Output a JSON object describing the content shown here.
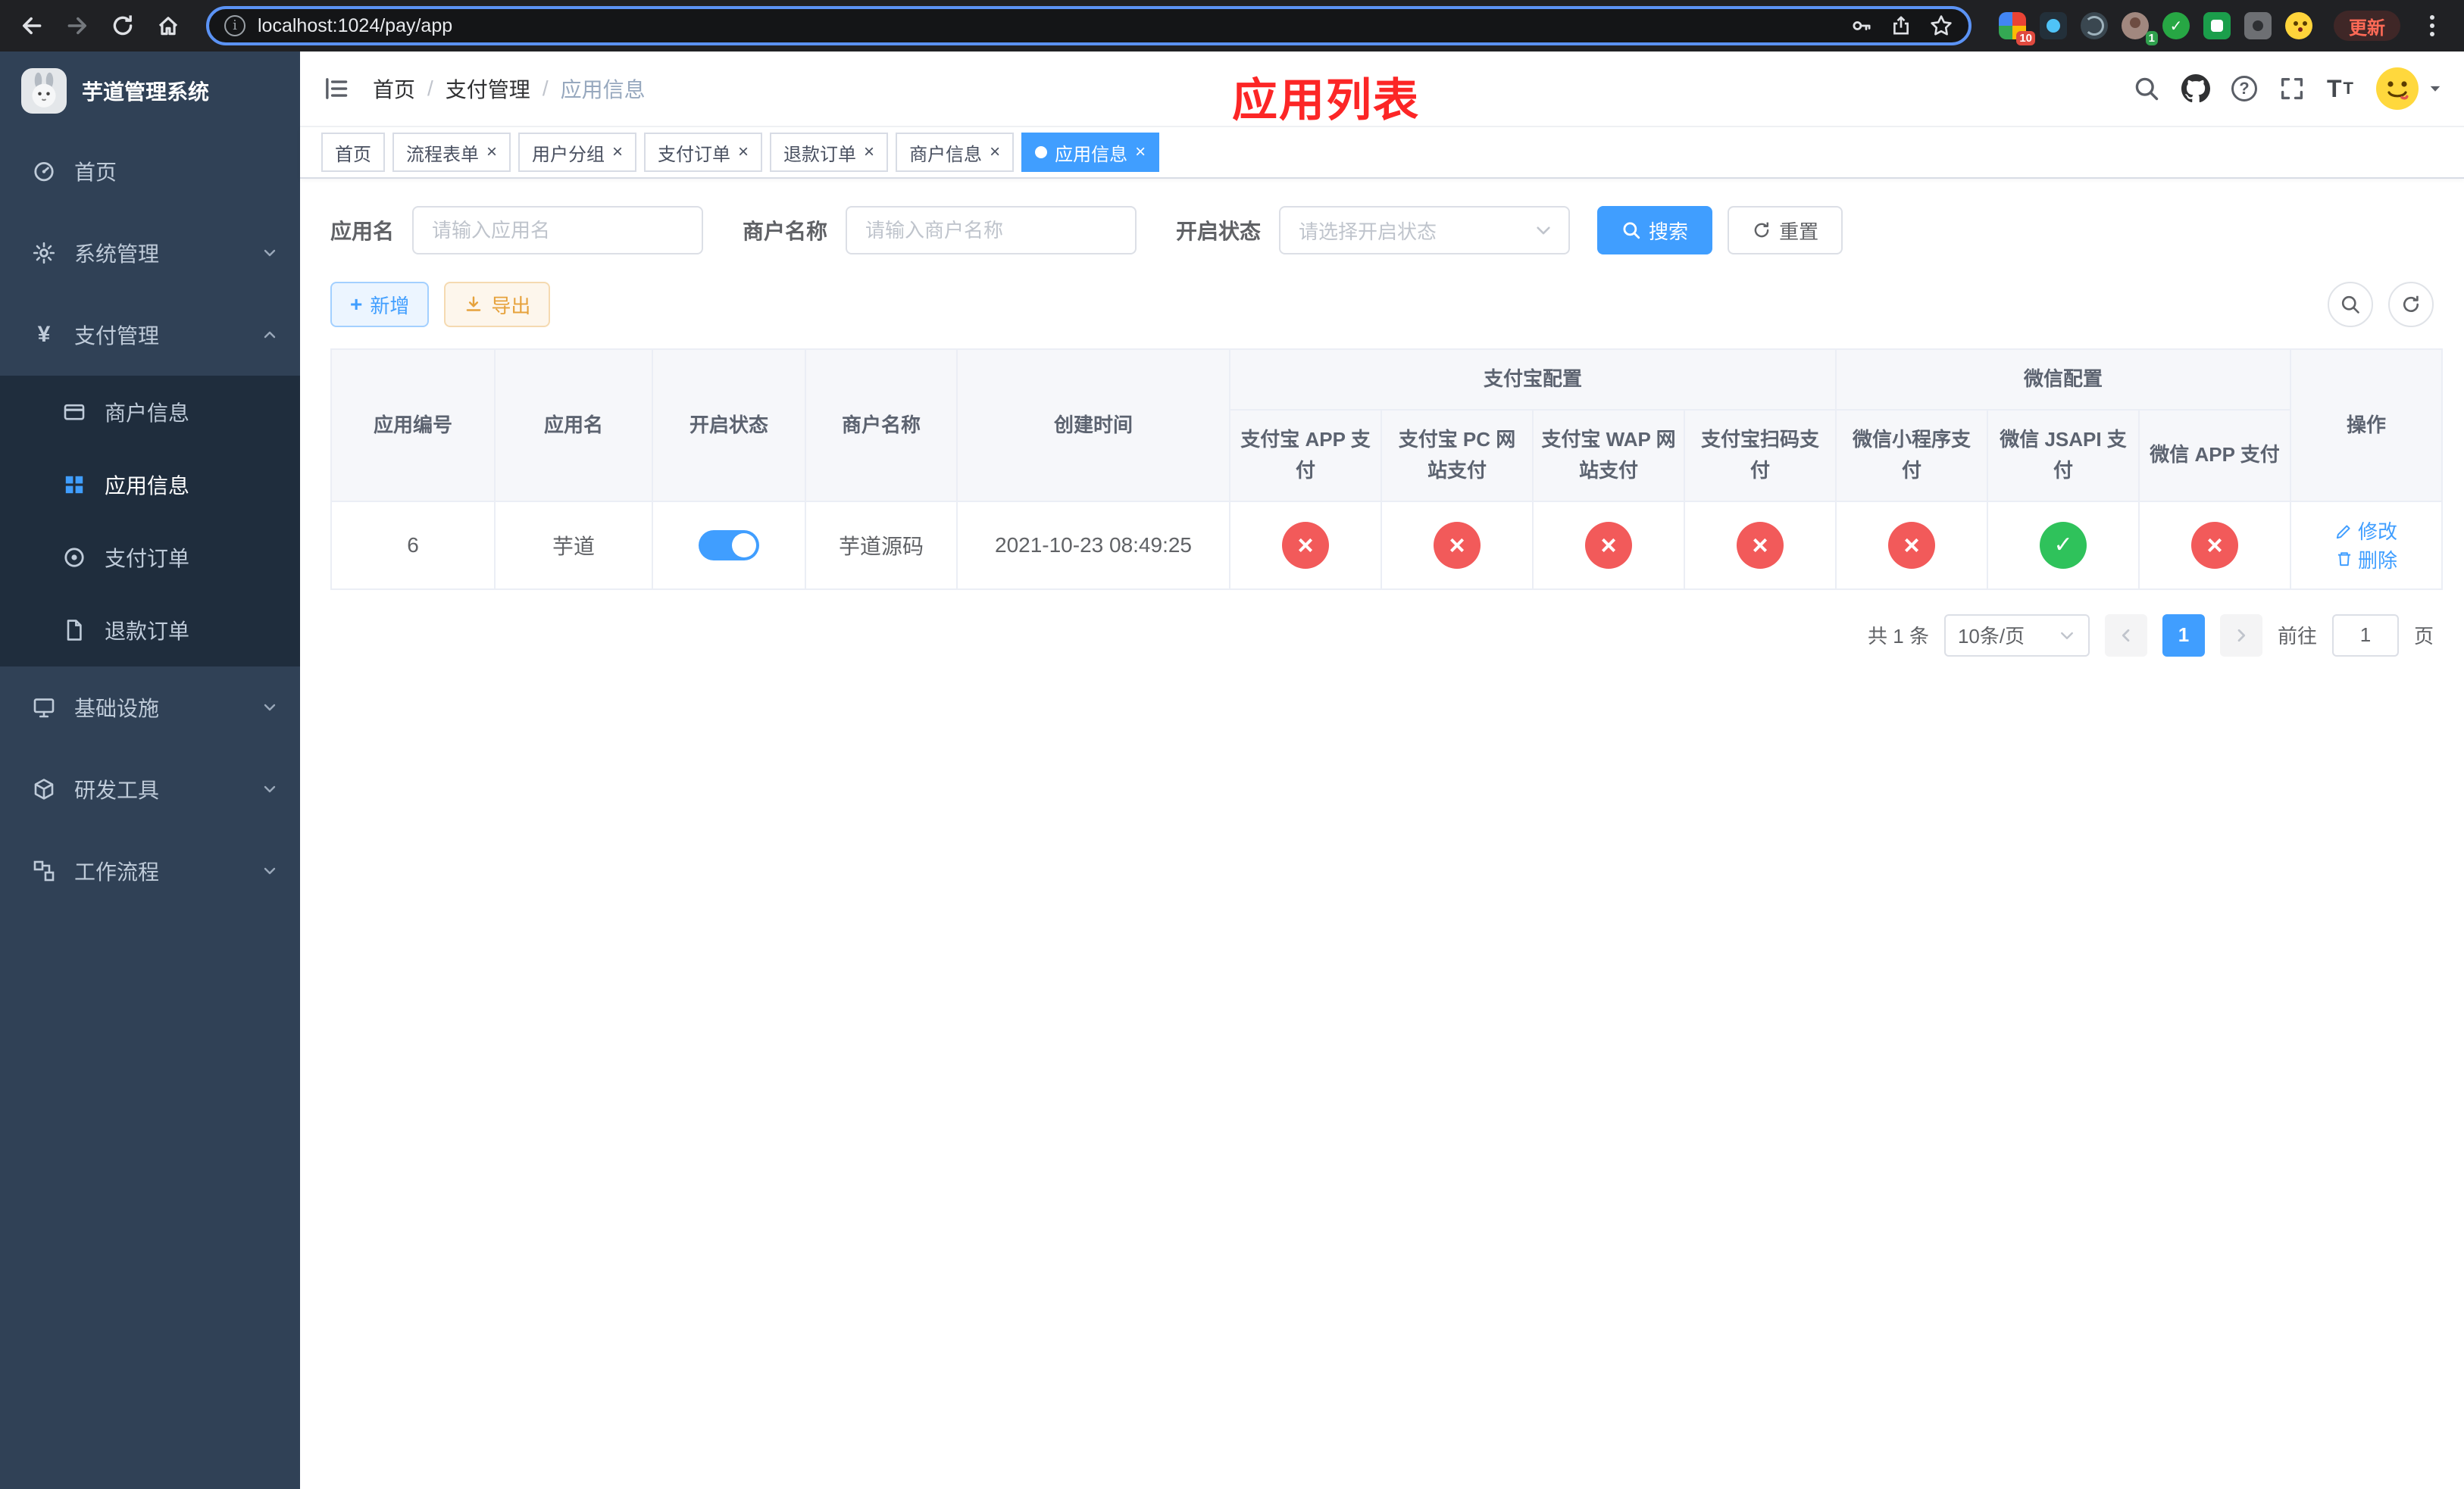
{
  "colors": {
    "accent": "#409eff",
    "success": "#2fc25b",
    "danger": "#f25a5a",
    "sidebar_bg": "#304156",
    "submenu_bg": "#1f2d3d",
    "annotation_red": "#fc2626"
  },
  "browser": {
    "url": "localhost:1024/pay/app",
    "update_label": "更新",
    "extension_badge_count": "10",
    "profile_badge_count": "1"
  },
  "sidebar": {
    "title": "芋道管理系统",
    "items": [
      {
        "label": "首页"
      },
      {
        "label": "系统管理"
      },
      {
        "label": "支付管理"
      },
      {
        "label": "基础设施"
      },
      {
        "label": "研发工具"
      },
      {
        "label": "工作流程"
      }
    ],
    "payment_children": [
      {
        "label": "商户信息"
      },
      {
        "label": "应用信息"
      },
      {
        "label": "支付订单"
      },
      {
        "label": "退款订单"
      }
    ]
  },
  "navbar": {
    "breadcrumb": [
      "首页",
      "支付管理",
      "应用信息"
    ],
    "annotation": "应用列表"
  },
  "tabs": [
    {
      "label": "首页"
    },
    {
      "label": "流程表单"
    },
    {
      "label": "用户分组"
    },
    {
      "label": "支付订单"
    },
    {
      "label": "退款订单"
    },
    {
      "label": "商户信息"
    },
    {
      "label": "应用信息"
    }
  ],
  "filters": {
    "app_name_label": "应用名",
    "app_name_placeholder": "请输入应用名",
    "merchant_label": "商户名称",
    "merchant_placeholder": "请输入商户名称",
    "status_label": "开启状态",
    "status_placeholder": "请选择开启状态",
    "search_label": "搜索",
    "reset_label": "重置"
  },
  "toolbar": {
    "add_label": "新增",
    "export_label": "导出"
  },
  "table": {
    "columns": {
      "id": "应用编号",
      "name": "应用名",
      "status": "开启状态",
      "merchant": "商户名称",
      "created": "创建时间",
      "alipay_group": "支付宝配置",
      "wechat_group": "微信配置",
      "actions": "操作"
    },
    "sub_columns": [
      "支付宝 APP 支付",
      "支付宝 PC 网站支付",
      "支付宝 WAP 网站支付",
      "支付宝扫码支付",
      "微信小程序支付",
      "微信 JSAPI 支付",
      "微信 APP 支付"
    ],
    "rows": [
      {
        "id": "6",
        "name": "芋道",
        "status": "on",
        "merchant": "芋道源码",
        "created": "2021-10-23 08:49:25",
        "configs": [
          "error",
          "error",
          "error",
          "error",
          "error",
          "success",
          "error"
        ],
        "edit_label": "修改",
        "delete_label": "删除"
      }
    ]
  },
  "pagination": {
    "total": "共 1 条",
    "page_size": "10条/页",
    "current_page": "1",
    "goto_label": "前往",
    "goto_value": "1",
    "page_unit": "页"
  }
}
